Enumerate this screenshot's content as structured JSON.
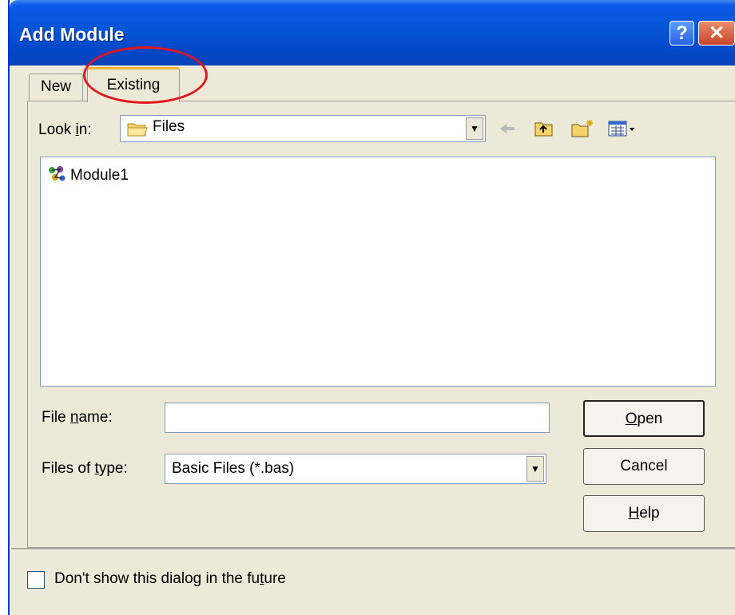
{
  "window": {
    "title": "Add Module"
  },
  "title_buttons": {
    "help": "?",
    "close": "✕"
  },
  "tabs": [
    {
      "label": "New"
    },
    {
      "label": "Existing"
    }
  ],
  "look_in": {
    "label_pre": "Look ",
    "label_key": "i",
    "label_post": "n:",
    "value": "Files"
  },
  "files": [
    {
      "name": "Module1",
      "icon": "vb-module-icon"
    }
  ],
  "file_name": {
    "label_pre": "File ",
    "label_key": "n",
    "label_post": "ame:",
    "value": ""
  },
  "file_type": {
    "label_pre": "Files of ",
    "label_key": "t",
    "label_post": "ype:",
    "value": "Basic Files (*.bas)"
  },
  "buttons": {
    "open": {
      "key": "O",
      "rest": "pen"
    },
    "cancel": "Cancel",
    "help": {
      "key": "H",
      "rest": "elp"
    }
  },
  "dont_show": {
    "pre": "Don't show this dialog in the fu",
    "key": "t",
    "post": "ure",
    "checked": false
  },
  "colors": {
    "title_bar": "#0346C7",
    "dialog_bg": "#ECE9D8",
    "highlight_circle": "#E5151C"
  }
}
